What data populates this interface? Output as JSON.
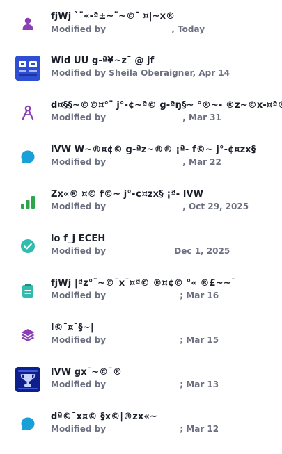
{
  "items": [
    {
      "title": "fjWj `¨«-ª±~¨~©¯ ¤|~x®",
      "modified_label": "Modified by",
      "author": "",
      "date": ", Today",
      "icon": "person-icon"
    },
    {
      "title": "Wid UU g-ª¥~z¯ @ jf",
      "modified_label": "Modified by",
      "author": "Sheila Oberaigner",
      "date": ", Apr 14",
      "icon": "app-thumbnail-icon"
    },
    {
      "title": "d¤§§~©©¤°¨ j°-¢~ª© g-ªŋ§~ °®~- ®z~©x-¤ª®",
      "modified_label": "Modified by",
      "author": "",
      "date": ", Mar 31",
      "icon": "compass-icon"
    },
    {
      "title": "lVW W~®¤¢© g-ªz~®® ¡ª- f©~ j°-¢¤zx§",
      "modified_label": "Modified by",
      "author": "",
      "date": ", Mar 22",
      "icon": "chat-bubble-icon"
    },
    {
      "title": "Zx«® ¤© f©~ j°-¢¤zx§ ¡ª- lVW",
      "modified_label": "Modified by",
      "author": "",
      "date": ", Oct 29, 2025",
      "icon": "bar-chart-icon"
    },
    {
      "title": "lo f_j ECEH",
      "modified_label": "Modified by",
      "author": "",
      "date": "Dec 1, 2025",
      "icon": "check-circle-icon"
    },
    {
      "title": "fjWj |ªz°¨~©¯x¯¤ª© ®¤¢© °« ®£~~¯",
      "modified_label": "Modified by",
      "author": "",
      "date": "; Mar 16",
      "icon": "clipboard-icon"
    },
    {
      "title": "l©¯¤¯§~|",
      "modified_label": "Modified by",
      "author": "",
      "date": "; Mar 15",
      "icon": "layers-icon"
    },
    {
      "title": "lVW gx¯~©¯®",
      "modified_label": "Modified by",
      "author": "",
      "date": "; Mar 13",
      "icon": "trophy-thumbnail-icon"
    },
    {
      "title": "dª©¯x¤© §x©|®zx«~",
      "modified_label": "Modified by",
      "author": "",
      "date": "; Mar 12",
      "icon": "chat-bubble-icon"
    }
  ]
}
